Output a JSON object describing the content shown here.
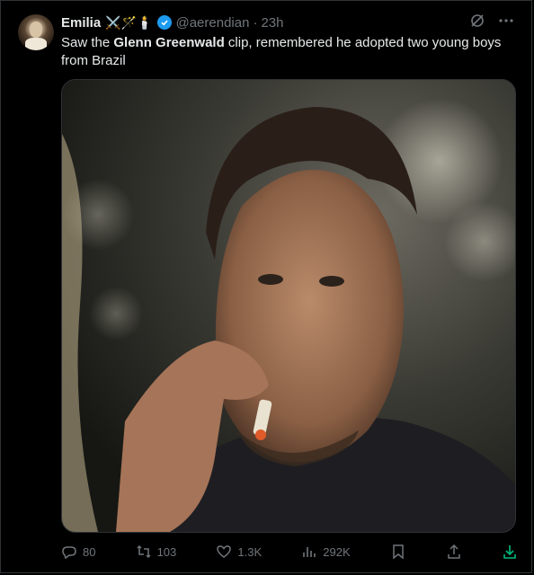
{
  "author": {
    "name": "Emilia",
    "badges": "⚔️🪄🕯️",
    "handle": "@aerendian",
    "separator": "·",
    "time": "23h"
  },
  "tweet": {
    "text_before": "Saw the ",
    "text_bold": "Glenn Greenwald",
    "text_after": " clip, remembered he adopted two young boys from Brazil"
  },
  "media": {
    "description": "Film still of a man smoking a cigarette"
  },
  "actions": {
    "replies": "80",
    "reposts": "103",
    "likes": "1.3K",
    "views": "292K"
  },
  "icons": [
    "grok-icon",
    "more-icon",
    "reply-icon",
    "repost-icon",
    "like-icon",
    "views-icon",
    "bookmark-icon",
    "share-icon",
    "download-icon"
  ],
  "colors": {
    "accent": "#1d9bf0",
    "muted": "#71767b",
    "text": "#e7e9ea",
    "download": "#00ba7c"
  }
}
